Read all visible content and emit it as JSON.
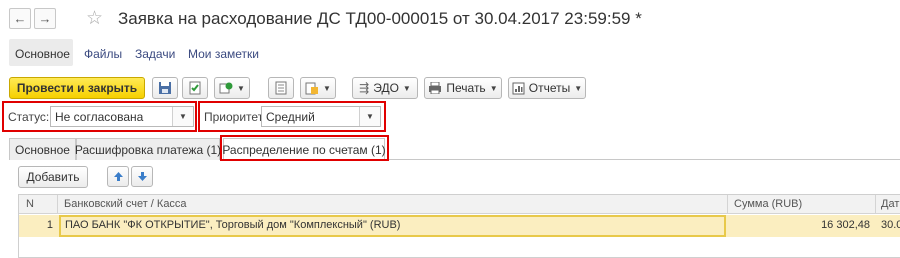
{
  "window": {
    "title": "Заявка на расходование ДС ТД00-000015 от 30.04.2017 23:59:59 *"
  },
  "nav": {
    "back_icon": "←",
    "forward_icon": "→",
    "favorite_icon": "☆"
  },
  "section_links": [
    "Основное",
    "Файлы",
    "Задачи",
    "Мои заметки"
  ],
  "toolbar": {
    "post_close_label": "Провести и закрыть",
    "edo_label": "ЭДО",
    "print_label": "Печать",
    "reports_label": "Отчеты"
  },
  "fields": {
    "status_label": "Статус:",
    "status_value": "Не согласована",
    "priority_label": "Приоритет:",
    "priority_value": "Средний"
  },
  "tabs": [
    "Основное",
    "Расшифровка платежа (1)",
    "Распределение по счетам (1)"
  ],
  "table_toolbar": {
    "add_label": "Добавить"
  },
  "table": {
    "columns": [
      "N",
      "Банковский счет / Касса",
      "Сумма (RUB)",
      "Дат"
    ],
    "rows": [
      {
        "n": "1",
        "account": "ПАО БАНК \"ФК ОТКРЫТИЕ\", Торговый дом \"Комплексный\" (RUB)",
        "amount": "16 302,48",
        "date": "30.0"
      }
    ]
  },
  "colors": {
    "primary_button": "#f6d000",
    "highlight_box": "#e00000",
    "selected_row": "#fbeec0",
    "selected_cell_border": "#e8c94a"
  }
}
